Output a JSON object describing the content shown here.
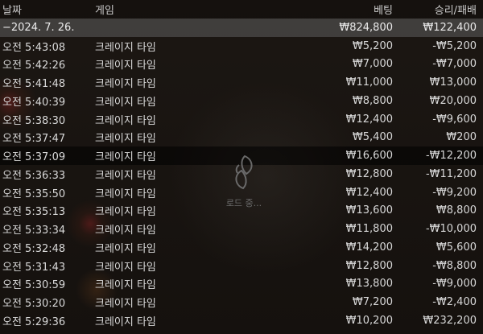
{
  "headers": {
    "date": "날짜",
    "game": "게임",
    "bet": "베팅",
    "result": "승리/패배"
  },
  "summary": {
    "date": "−2024. 7. 26.",
    "bet": "₩824,800",
    "result": "₩122,400"
  },
  "rows": [
    {
      "time": "오전 5:43:08",
      "game": "크레이지 타임",
      "bet": "₩5,200",
      "result": "-₩5,200"
    },
    {
      "time": "오전 5:42:26",
      "game": "크레이지 타임",
      "bet": "₩7,000",
      "result": "-₩7,000"
    },
    {
      "time": "오전 5:41:48",
      "game": "크레이지 타임",
      "bet": "₩11,000",
      "result": "₩13,000"
    },
    {
      "time": "오전 5:40:39",
      "game": "크레이지 타임",
      "bet": "₩8,800",
      "result": "₩20,000"
    },
    {
      "time": "오전 5:38:30",
      "game": "크레이지 타임",
      "bet": "₩12,400",
      "result": "-₩9,600"
    },
    {
      "time": "오전 5:37:47",
      "game": "크레이지 타임",
      "bet": "₩5,400",
      "result": "₩200"
    },
    {
      "time": "오전 5:37:09",
      "game": "크레이지 타임",
      "bet": "₩16,600",
      "result": "-₩12,200"
    },
    {
      "time": "오전 5:36:33",
      "game": "크레이지 타임",
      "bet": "₩12,800",
      "result": "-₩11,200"
    },
    {
      "time": "오전 5:35:50",
      "game": "크레이지 타임",
      "bet": "₩12,400",
      "result": "-₩9,200"
    },
    {
      "time": "오전 5:35:13",
      "game": "크레이지 타임",
      "bet": "₩13,600",
      "result": "₩8,800"
    },
    {
      "time": "오전 5:33:34",
      "game": "크레이지 타임",
      "bet": "₩11,800",
      "result": "-₩10,000"
    },
    {
      "time": "오전 5:32:48",
      "game": "크레이지 타임",
      "bet": "₩14,200",
      "result": "₩5,600"
    },
    {
      "time": "오전 5:31:43",
      "game": "크레이지 타임",
      "bet": "₩12,800",
      "result": "-₩8,800"
    },
    {
      "time": "오전 5:30:59",
      "game": "크레이지 타임",
      "bet": "₩13,800",
      "result": "-₩9,000"
    },
    {
      "time": "오전 5:30:20",
      "game": "크레이지 타임",
      "bet": "₩7,200",
      "result": "-₩2,400"
    },
    {
      "time": "오전 5:29:36",
      "game": "크레이지 타임",
      "bet": "₩10,200",
      "result": "₩232,200"
    }
  ],
  "loading": {
    "text": "로드 중...",
    "icon": "leaf-spinner-icon"
  }
}
